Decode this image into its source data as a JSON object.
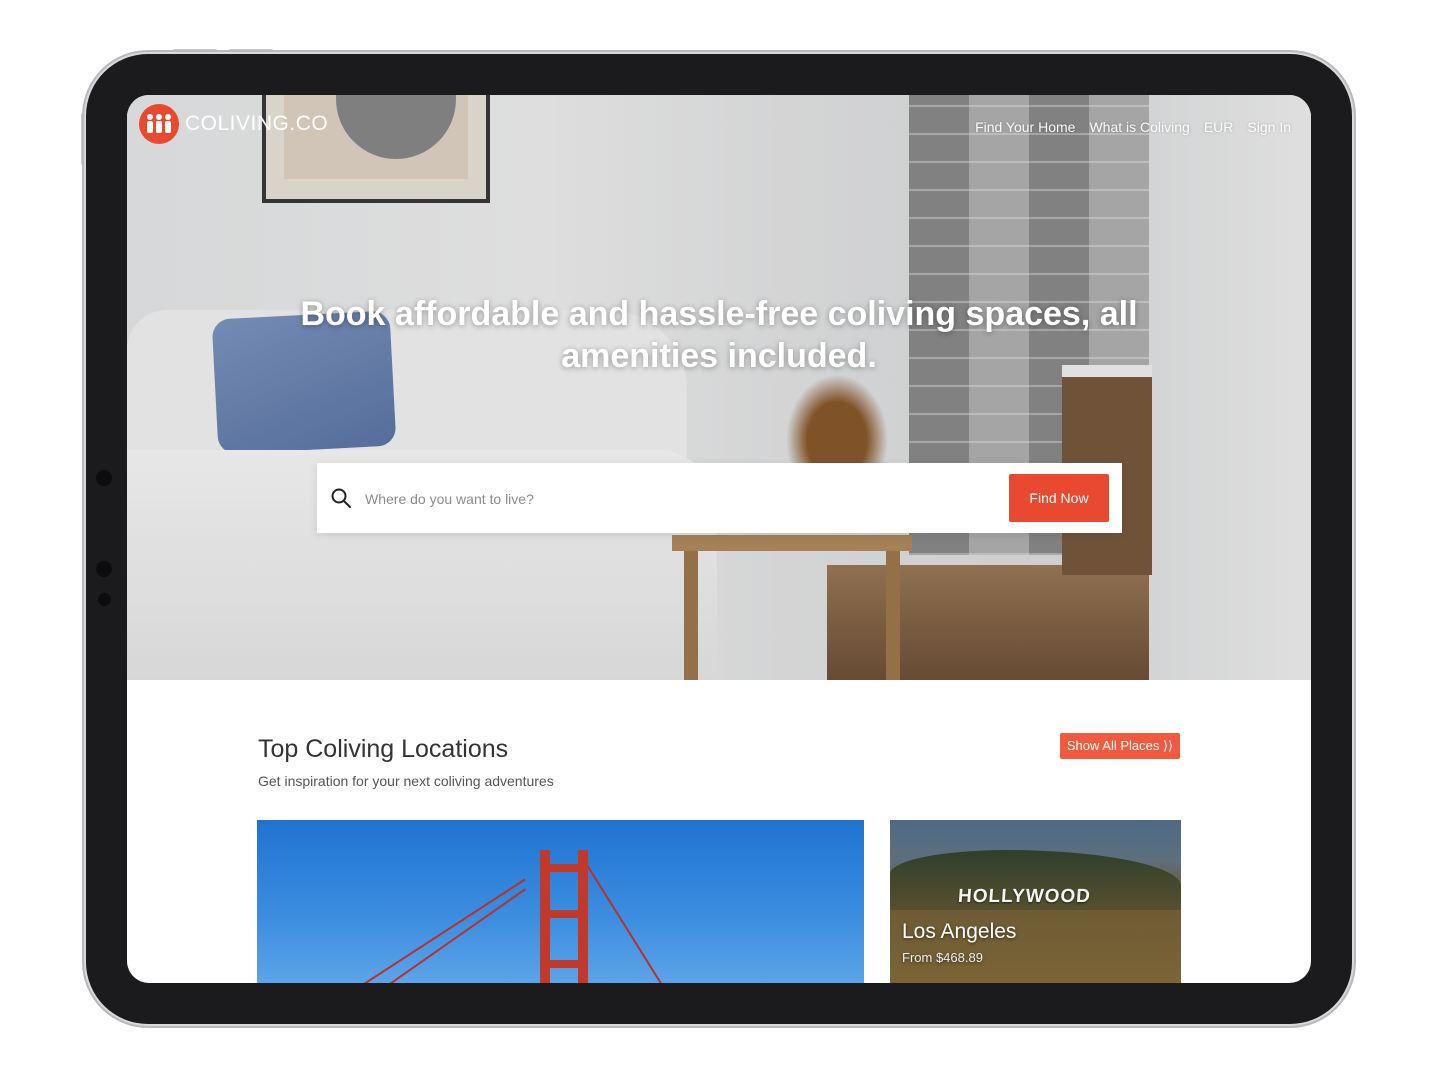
{
  "brand": {
    "name": "COLIVING.CO",
    "accent": "#e8492f"
  },
  "nav": {
    "items": [
      {
        "label": "Find Your Home"
      },
      {
        "label": "What is Coliving"
      },
      {
        "label": "EUR"
      },
      {
        "label": "Sign In"
      }
    ]
  },
  "hero": {
    "headline": "Book affordable and hassle-free coliving spaces, all amenities included.",
    "search": {
      "placeholder": "Where do you want to live?",
      "value": "",
      "icon": "search-icon"
    },
    "cta_label": "Find Now"
  },
  "locations": {
    "title": "Top Coliving Locations",
    "subtitle": "Get inspiration for your next coliving adventures",
    "show_all_label": "Show All Places ⟩⟩",
    "cards": [
      {
        "image": "golden-gate-bridge"
      },
      {
        "image": "hollywood-sign",
        "sign_text": "HOLLYWOOD",
        "city": "Los Angeles",
        "price": "From $468.89"
      }
    ]
  }
}
